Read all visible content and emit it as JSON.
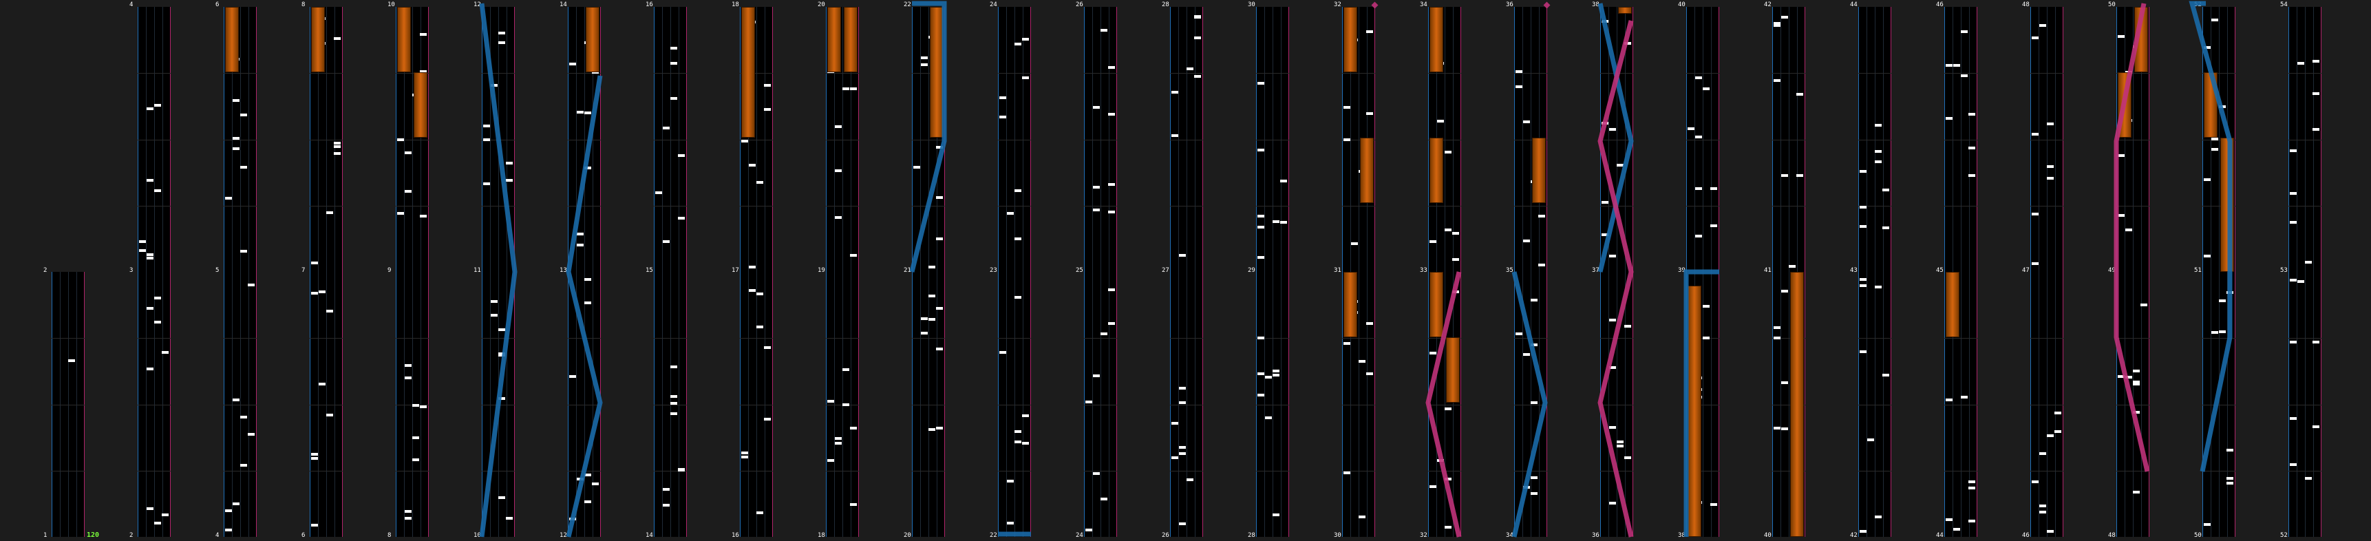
{
  "chart_view": {
    "combo_value": "120",
    "colors": {
      "background": "#1c1c1c",
      "lane_bg": "#000000",
      "left_edge": "#1f6fb8",
      "right_edge": "#b0246a",
      "hold": "#d4650f",
      "blue_laser": "#1a6aa8",
      "pink_laser": "#c0327a",
      "note": "#ffffff",
      "combo": "#7cff3a"
    },
    "top_row_numbers": [
      "4",
      "6",
      "8",
      "10",
      "12",
      "14",
      "16",
      "18",
      "20",
      "22",
      "24",
      "26",
      "28",
      "30",
      "32",
      "34",
      "36",
      "38",
      "40",
      "42",
      "44",
      "46",
      "48",
      "50",
      "52",
      "54"
    ],
    "mid_row_numbers": [
      "2",
      "3",
      "5",
      "7",
      "9",
      "11",
      "13",
      "15",
      "17",
      "19",
      "21",
      "23",
      "25",
      "27",
      "29",
      "31",
      "33",
      "35",
      "37",
      "39",
      "41",
      "43",
      "45",
      "47",
      "49",
      "51",
      "53"
    ],
    "bottom_row_numbers": [
      "1",
      "2",
      "4",
      "6",
      "8",
      "10",
      "12",
      "14",
      "16",
      "18",
      "20",
      "22",
      "24",
      "26",
      "28",
      "30",
      "32",
      "34",
      "36",
      "38",
      "40",
      "42",
      "44",
      "46",
      "48",
      "50",
      "52"
    ]
  }
}
